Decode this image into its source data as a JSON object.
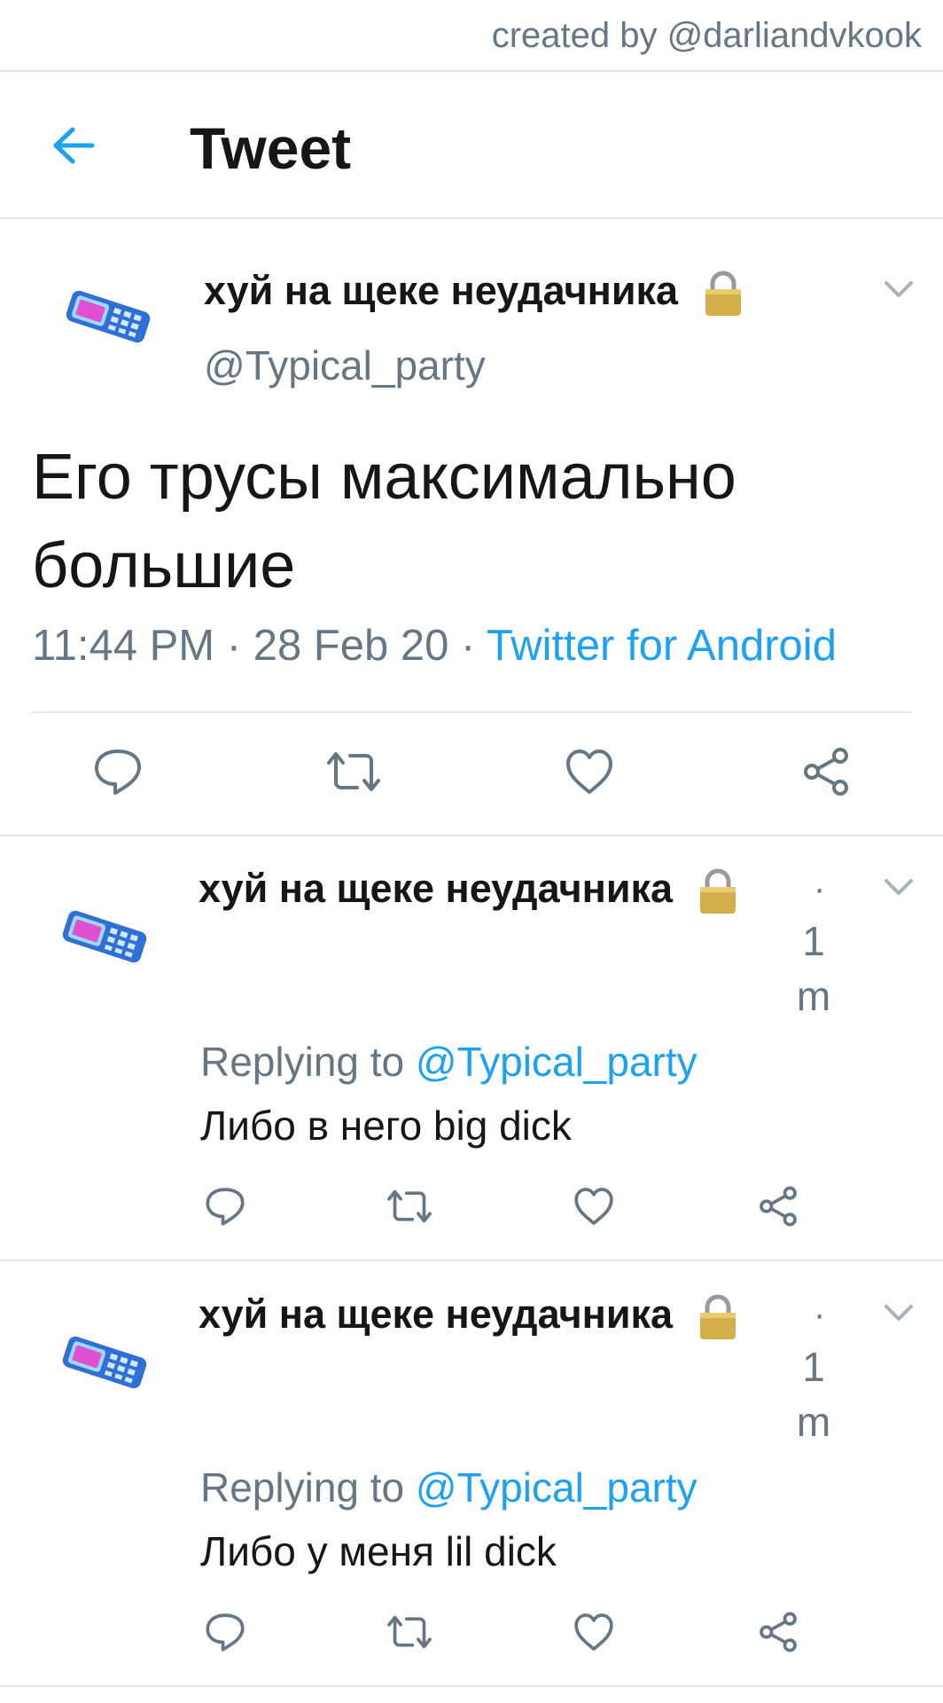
{
  "credit": "created by @darliandvkook",
  "header": {
    "title": "Tweet"
  },
  "main_tweet": {
    "display_name": "хуй на щеке неудачника",
    "handle": "@Typical_party",
    "text": "Его трусы максимально большие",
    "time": "11:44 PM",
    "separator1": "·",
    "date": "28 Feb 20",
    "separator2": "·",
    "source": "Twitter for Android"
  },
  "replies": [
    {
      "display_name": "хуй на щеке неудачника",
      "dot": "·",
      "time_num": "1",
      "time_unit": "m",
      "replying_prefix": "Replying to",
      "replying_to": "@Typical_party",
      "text": "Либо в него big dick"
    },
    {
      "display_name": "хуй на щеке неудачника",
      "dot": "·",
      "time_num": "1",
      "time_unit": "m",
      "replying_prefix": "Replying to",
      "replying_to": "@Typical_party",
      "text": "Либо у меня lil dick"
    }
  ],
  "colors": {
    "accent": "#1da1f2",
    "secondary_text": "#657786",
    "icon": "#657786",
    "divider": "#e1e8ed"
  },
  "icons": {
    "back": "arrow-left-icon",
    "lock": "lock-icon",
    "chevron": "chevron-down-icon",
    "reply": "reply-icon",
    "retweet": "retweet-icon",
    "like": "heart-icon",
    "share": "share-icon"
  }
}
